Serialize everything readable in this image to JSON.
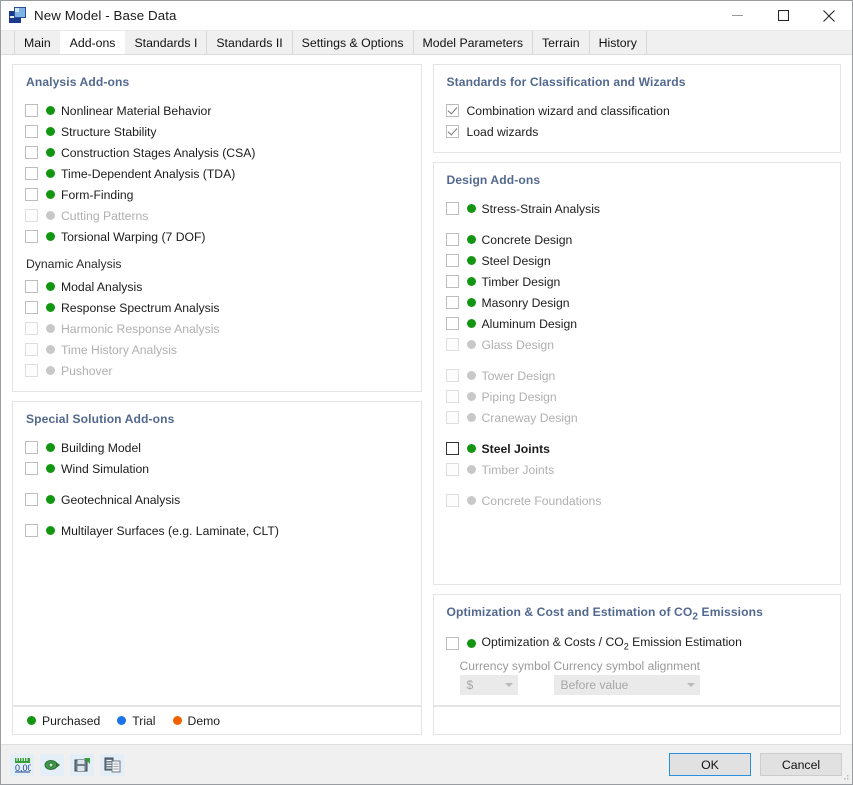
{
  "window": {
    "title": "New Model - Base Data",
    "app_icon": "model-document-icon",
    "minimize_label": "Minimize",
    "maximize_label": "Maximize",
    "close_label": "Close"
  },
  "tabs": [
    {
      "label": "Main",
      "active": false
    },
    {
      "label": "Add-ons",
      "active": true
    },
    {
      "label": "Standards I",
      "active": false
    },
    {
      "label": "Standards II",
      "active": false
    },
    {
      "label": "Settings & Options",
      "active": false
    },
    {
      "label": "Model Parameters",
      "active": false
    },
    {
      "label": "Terrain",
      "active": false
    },
    {
      "label": "History",
      "active": false
    }
  ],
  "left": {
    "analysis": {
      "title": "Analysis Add-ons",
      "items": [
        {
          "label": "Nonlinear Material Behavior",
          "checked": false,
          "status": "purchased",
          "disabled": false
        },
        {
          "label": "Structure Stability",
          "checked": false,
          "status": "purchased",
          "disabled": false
        },
        {
          "label": "Construction Stages Analysis (CSA)",
          "checked": false,
          "status": "purchased",
          "disabled": false
        },
        {
          "label": "Time-Dependent Analysis (TDA)",
          "checked": false,
          "status": "purchased",
          "disabled": false
        },
        {
          "label": "Form-Finding",
          "checked": false,
          "status": "purchased",
          "disabled": false
        },
        {
          "label": "Cutting Patterns",
          "checked": false,
          "status": "off",
          "disabled": true
        },
        {
          "label": "Torsional Warping (7 DOF)",
          "checked": false,
          "status": "purchased",
          "disabled": false
        }
      ],
      "subhead": "Dynamic Analysis",
      "dynamic_items": [
        {
          "label": "Modal Analysis",
          "checked": false,
          "status": "purchased",
          "disabled": false
        },
        {
          "label": "Response Spectrum Analysis",
          "checked": false,
          "status": "purchased",
          "disabled": false
        },
        {
          "label": "Harmonic Response Analysis",
          "checked": false,
          "status": "off",
          "disabled": true
        },
        {
          "label": "Time History Analysis",
          "checked": false,
          "status": "off",
          "disabled": true
        },
        {
          "label": "Pushover",
          "checked": false,
          "status": "off",
          "disabled": true
        }
      ]
    },
    "special": {
      "title": "Special Solution Add-ons",
      "items": [
        {
          "label": "Building Model",
          "checked": false,
          "status": "purchased",
          "disabled": false
        },
        {
          "label": "Wind Simulation",
          "checked": false,
          "status": "purchased",
          "disabled": false
        },
        {
          "label": "Geotechnical Analysis",
          "checked": false,
          "status": "purchased",
          "disabled": false
        },
        {
          "label": "Multilayer Surfaces (e.g. Laminate, CLT)",
          "checked": false,
          "status": "purchased",
          "disabled": false
        }
      ]
    }
  },
  "right": {
    "standards": {
      "title": "Standards for Classification and Wizards",
      "items": [
        {
          "label": "Combination wizard and classification",
          "checked": true
        },
        {
          "label": "Load wizards",
          "checked": true
        }
      ]
    },
    "design": {
      "title": "Design Add-ons",
      "items": [
        {
          "label": "Stress-Strain Analysis",
          "checked": false,
          "status": "purchased",
          "disabled": false
        },
        {
          "label": "Concrete Design",
          "checked": false,
          "status": "purchased",
          "disabled": false
        },
        {
          "label": "Steel Design",
          "checked": false,
          "status": "purchased",
          "disabled": false
        },
        {
          "label": "Timber Design",
          "checked": false,
          "status": "purchased",
          "disabled": false
        },
        {
          "label": "Masonry Design",
          "checked": false,
          "status": "purchased",
          "disabled": false
        },
        {
          "label": "Aluminum Design",
          "checked": false,
          "status": "purchased",
          "disabled": false
        },
        {
          "label": "Glass Design",
          "checked": false,
          "status": "off",
          "disabled": true
        },
        {
          "label": "Tower Design",
          "checked": false,
          "status": "off",
          "disabled": true
        },
        {
          "label": "Piping Design",
          "checked": false,
          "status": "off",
          "disabled": true
        },
        {
          "label": "Craneway Design",
          "checked": false,
          "status": "off",
          "disabled": true
        },
        {
          "label": "Steel Joints",
          "checked": false,
          "status": "purchased",
          "disabled": false,
          "focused": true
        },
        {
          "label": "Timber Joints",
          "checked": false,
          "status": "off",
          "disabled": true
        },
        {
          "label": "Concrete Foundations",
          "checked": false,
          "status": "off",
          "disabled": true
        }
      ]
    },
    "optimization": {
      "title_pre": "Optimization & Cost and Estimation of CO",
      "title_sub": "2",
      "title_post": " Emissions",
      "item_pre": "Optimization & Costs / CO",
      "item_sub": "2",
      "item_post": " Emission Estimation",
      "item_checked": false,
      "item_status": "purchased",
      "currency_symbol_label": "Currency symbol",
      "currency_symbol_value": "$",
      "currency_alignment_label": "Currency symbol alignment",
      "currency_alignment_value": "Before value"
    }
  },
  "legend": [
    {
      "label": "Purchased",
      "status": "purchased"
    },
    {
      "label": "Trial",
      "status": "trial"
    },
    {
      "label": "Demo",
      "status": "demo"
    }
  ],
  "footer": {
    "tools": [
      {
        "name": "units-decimal-places-icon"
      },
      {
        "name": "transfer-settings-icon"
      },
      {
        "name": "save-settings-icon"
      },
      {
        "name": "copy-from-model-icon"
      }
    ],
    "ok_label": "OK",
    "cancel_label": "Cancel"
  }
}
